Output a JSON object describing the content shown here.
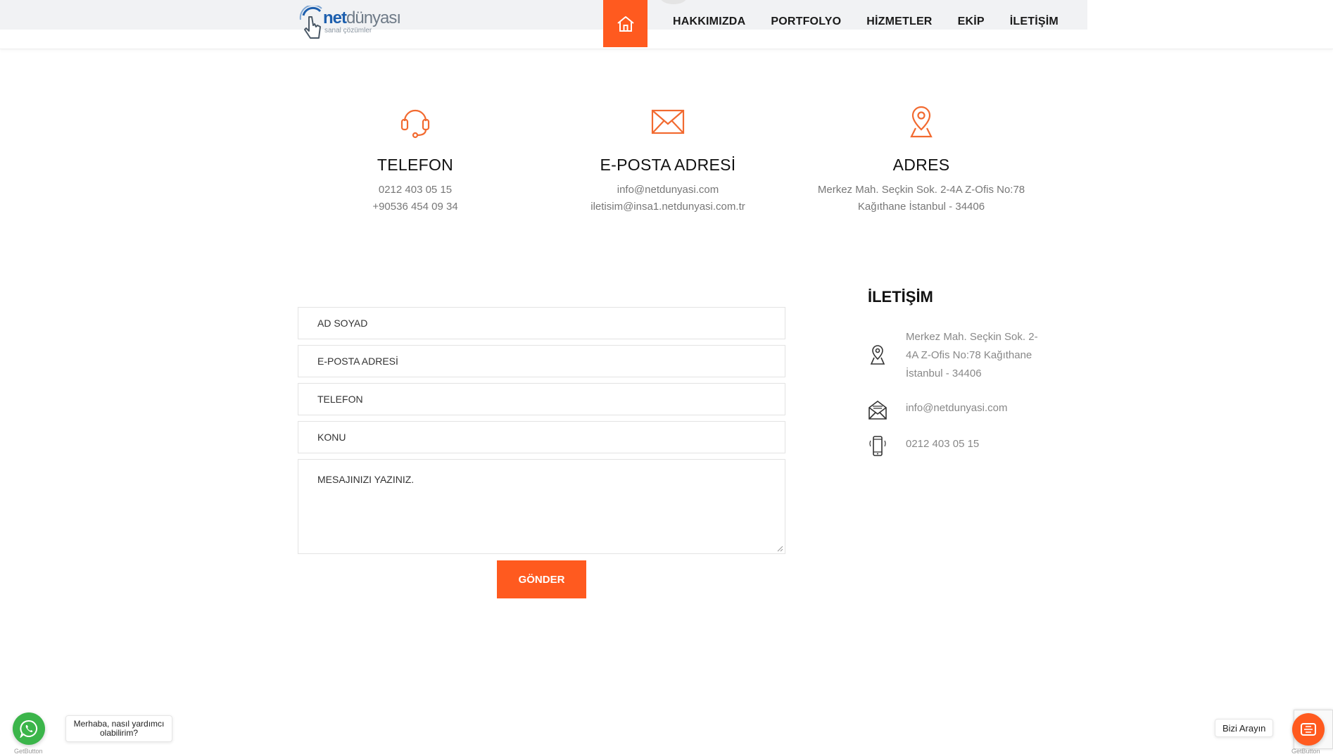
{
  "header": {
    "logo_net": "net",
    "logo_dunyasi": "dünyası",
    "logo_sub": "sanal çözümler",
    "nav": [
      "HAKKIMIZDA",
      "PORTFOLYO",
      "HİZMETLER",
      "EKİP",
      "İLETİŞİM"
    ],
    "home_icon": "home-icon",
    "accent": "#ff5a1f"
  },
  "info": {
    "phone": {
      "icon": "headset-icon",
      "title": "TELEFON",
      "lines": [
        "0212 403 05 15",
        "+90536 454 09 34"
      ]
    },
    "email": {
      "icon": "envelope-icon",
      "title": "E-POSTA ADRESİ",
      "lines": [
        "info@netdunyasi.com",
        "iletisim@insa1.netdunyasi.com.tr"
      ]
    },
    "address": {
      "icon": "location-pin-icon",
      "title": "ADRES",
      "lines": [
        "Merkez Mah. Seçkin Sok. 2-4A Z-Ofis No:78",
        "Kağıthane İstanbul - 34406"
      ]
    }
  },
  "form": {
    "name_placeholder": "AD SOYAD",
    "email_placeholder": "E-POSTA ADRESİ",
    "phone_placeholder": "TELEFON",
    "subject_placeholder": "KONU",
    "message_placeholder": "MESAJINIZI YAZINIZ.",
    "submit_label": "GÖNDER"
  },
  "contact": {
    "title": "İLETİŞİM",
    "address": "Merkez Mah. Seçkin Sok. 2-4A Z-Ofis No:78 Kağıthane İstanbul - 34406",
    "email": "info@netdunyasi.com",
    "phone": "0212 403 05 15"
  },
  "widgets": {
    "whatsapp_bubble": "Merhaba, nasıl yardımcı olabilirim?",
    "whatsapp_brand": "GetButton",
    "call_label": "Bizi Arayın",
    "call_brand": "GetButton",
    "whatsapp_color": "#3bb54a"
  }
}
